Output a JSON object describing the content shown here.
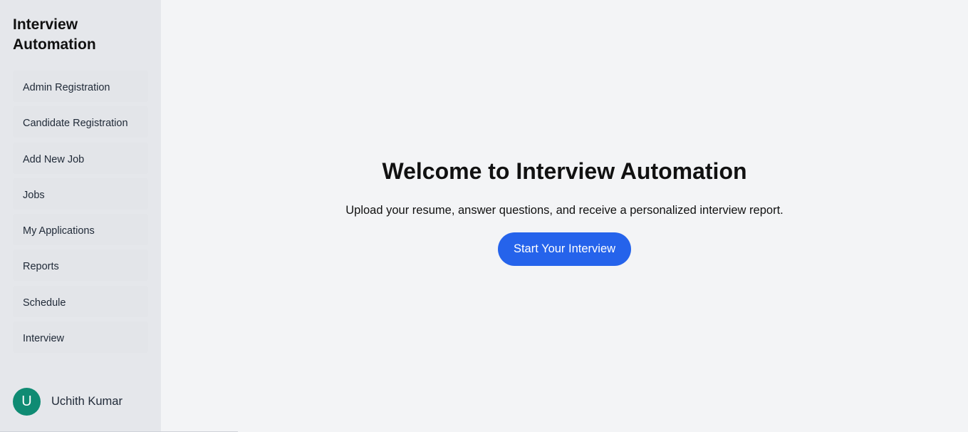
{
  "sidebar": {
    "brand": "Interview Automation",
    "items": [
      {
        "label": "Admin Registration"
      },
      {
        "label": "Candidate Registration"
      },
      {
        "label": "Add New Job"
      },
      {
        "label": "Jobs"
      },
      {
        "label": "My Applications"
      },
      {
        "label": "Reports"
      },
      {
        "label": "Schedule"
      },
      {
        "label": "Interview"
      }
    ],
    "user": {
      "initial": "U",
      "name": "Uchith Kumar"
    }
  },
  "main": {
    "title": "Welcome to Interview Automation",
    "subtitle": "Upload your resume, answer questions, and receive a personalized interview report.",
    "cta_label": "Start Your Interview"
  },
  "colors": {
    "sidebar_bg": "#e5e7eb",
    "main_bg": "#f3f4f6",
    "accent": "#2563eb",
    "avatar": "#0f8b73"
  }
}
